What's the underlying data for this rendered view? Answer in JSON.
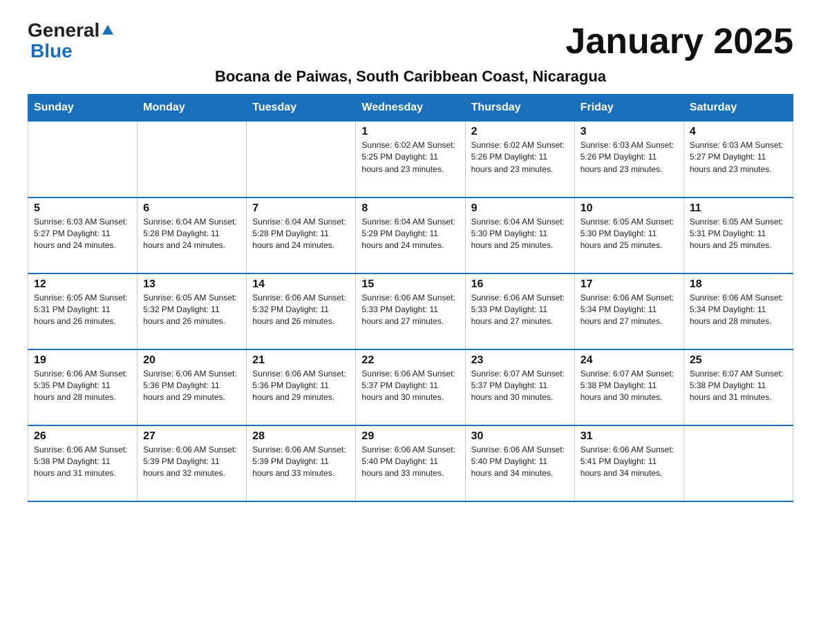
{
  "header": {
    "logo_general": "General",
    "logo_blue": "Blue",
    "month_title": "January 2025",
    "subtitle": "Bocana de Paiwas, South Caribbean Coast, Nicaragua"
  },
  "days_of_week": [
    "Sunday",
    "Monday",
    "Tuesday",
    "Wednesday",
    "Thursday",
    "Friday",
    "Saturday"
  ],
  "weeks": [
    [
      {
        "day": "",
        "info": ""
      },
      {
        "day": "",
        "info": ""
      },
      {
        "day": "",
        "info": ""
      },
      {
        "day": "1",
        "info": "Sunrise: 6:02 AM\nSunset: 5:25 PM\nDaylight: 11 hours and 23 minutes."
      },
      {
        "day": "2",
        "info": "Sunrise: 6:02 AM\nSunset: 5:26 PM\nDaylight: 11 hours and 23 minutes."
      },
      {
        "day": "3",
        "info": "Sunrise: 6:03 AM\nSunset: 5:26 PM\nDaylight: 11 hours and 23 minutes."
      },
      {
        "day": "4",
        "info": "Sunrise: 6:03 AM\nSunset: 5:27 PM\nDaylight: 11 hours and 23 minutes."
      }
    ],
    [
      {
        "day": "5",
        "info": "Sunrise: 6:03 AM\nSunset: 5:27 PM\nDaylight: 11 hours and 24 minutes."
      },
      {
        "day": "6",
        "info": "Sunrise: 6:04 AM\nSunset: 5:28 PM\nDaylight: 11 hours and 24 minutes."
      },
      {
        "day": "7",
        "info": "Sunrise: 6:04 AM\nSunset: 5:28 PM\nDaylight: 11 hours and 24 minutes."
      },
      {
        "day": "8",
        "info": "Sunrise: 6:04 AM\nSunset: 5:29 PM\nDaylight: 11 hours and 24 minutes."
      },
      {
        "day": "9",
        "info": "Sunrise: 6:04 AM\nSunset: 5:30 PM\nDaylight: 11 hours and 25 minutes."
      },
      {
        "day": "10",
        "info": "Sunrise: 6:05 AM\nSunset: 5:30 PM\nDaylight: 11 hours and 25 minutes."
      },
      {
        "day": "11",
        "info": "Sunrise: 6:05 AM\nSunset: 5:31 PM\nDaylight: 11 hours and 25 minutes."
      }
    ],
    [
      {
        "day": "12",
        "info": "Sunrise: 6:05 AM\nSunset: 5:31 PM\nDaylight: 11 hours and 26 minutes."
      },
      {
        "day": "13",
        "info": "Sunrise: 6:05 AM\nSunset: 5:32 PM\nDaylight: 11 hours and 26 minutes."
      },
      {
        "day": "14",
        "info": "Sunrise: 6:06 AM\nSunset: 5:32 PM\nDaylight: 11 hours and 26 minutes."
      },
      {
        "day": "15",
        "info": "Sunrise: 6:06 AM\nSunset: 5:33 PM\nDaylight: 11 hours and 27 minutes."
      },
      {
        "day": "16",
        "info": "Sunrise: 6:06 AM\nSunset: 5:33 PM\nDaylight: 11 hours and 27 minutes."
      },
      {
        "day": "17",
        "info": "Sunrise: 6:06 AM\nSunset: 5:34 PM\nDaylight: 11 hours and 27 minutes."
      },
      {
        "day": "18",
        "info": "Sunrise: 6:06 AM\nSunset: 5:34 PM\nDaylight: 11 hours and 28 minutes."
      }
    ],
    [
      {
        "day": "19",
        "info": "Sunrise: 6:06 AM\nSunset: 5:35 PM\nDaylight: 11 hours and 28 minutes."
      },
      {
        "day": "20",
        "info": "Sunrise: 6:06 AM\nSunset: 5:36 PM\nDaylight: 11 hours and 29 minutes."
      },
      {
        "day": "21",
        "info": "Sunrise: 6:06 AM\nSunset: 5:36 PM\nDaylight: 11 hours and 29 minutes."
      },
      {
        "day": "22",
        "info": "Sunrise: 6:06 AM\nSunset: 5:37 PM\nDaylight: 11 hours and 30 minutes."
      },
      {
        "day": "23",
        "info": "Sunrise: 6:07 AM\nSunset: 5:37 PM\nDaylight: 11 hours and 30 minutes."
      },
      {
        "day": "24",
        "info": "Sunrise: 6:07 AM\nSunset: 5:38 PM\nDaylight: 11 hours and 30 minutes."
      },
      {
        "day": "25",
        "info": "Sunrise: 6:07 AM\nSunset: 5:38 PM\nDaylight: 11 hours and 31 minutes."
      }
    ],
    [
      {
        "day": "26",
        "info": "Sunrise: 6:06 AM\nSunset: 5:38 PM\nDaylight: 11 hours and 31 minutes."
      },
      {
        "day": "27",
        "info": "Sunrise: 6:06 AM\nSunset: 5:39 PM\nDaylight: 11 hours and 32 minutes."
      },
      {
        "day": "28",
        "info": "Sunrise: 6:06 AM\nSunset: 5:39 PM\nDaylight: 11 hours and 33 minutes."
      },
      {
        "day": "29",
        "info": "Sunrise: 6:06 AM\nSunset: 5:40 PM\nDaylight: 11 hours and 33 minutes."
      },
      {
        "day": "30",
        "info": "Sunrise: 6:06 AM\nSunset: 5:40 PM\nDaylight: 11 hours and 34 minutes."
      },
      {
        "day": "31",
        "info": "Sunrise: 6:06 AM\nSunset: 5:41 PM\nDaylight: 11 hours and 34 minutes."
      },
      {
        "day": "",
        "info": ""
      }
    ]
  ]
}
